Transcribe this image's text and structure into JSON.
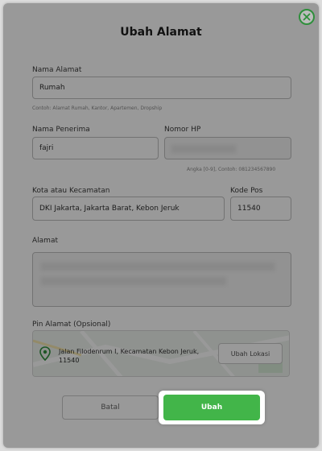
{
  "dialog": {
    "title": "Ubah Alamat",
    "close_icon": "close-circle-icon"
  },
  "form": {
    "address_name": {
      "label": "Nama Alamat",
      "value": "Rumah",
      "hint": "Contoh: Alamat Rumah, Kantor, Apartemen, Dropship"
    },
    "recipient": {
      "label": "Nama Penerima",
      "value": "fajri"
    },
    "phone": {
      "label": "Nomor HP",
      "value": "",
      "hint": "Angka [0-9], Contoh: 081234567890"
    },
    "district": {
      "label": "Kota atau Kecamatan",
      "value": "DKI Jakarta, Jakarta Barat, Kebon Jeruk"
    },
    "postal_code": {
      "label": "Kode Pos",
      "value": "11540"
    },
    "address": {
      "label": "Alamat",
      "value": ""
    },
    "pin": {
      "label": "Pin Alamat (Opsional)",
      "address_text": "Jalan Filodenrum I, Kecamatan Kebon Jeruk, 11540",
      "change_button": "Ubah Lokasi",
      "pin_icon": "map-pin-icon"
    }
  },
  "actions": {
    "cancel_label": "Batal",
    "submit_label": "Ubah"
  },
  "colors": {
    "accent_green": "#42b549",
    "close_green": "#2f8f3c"
  }
}
